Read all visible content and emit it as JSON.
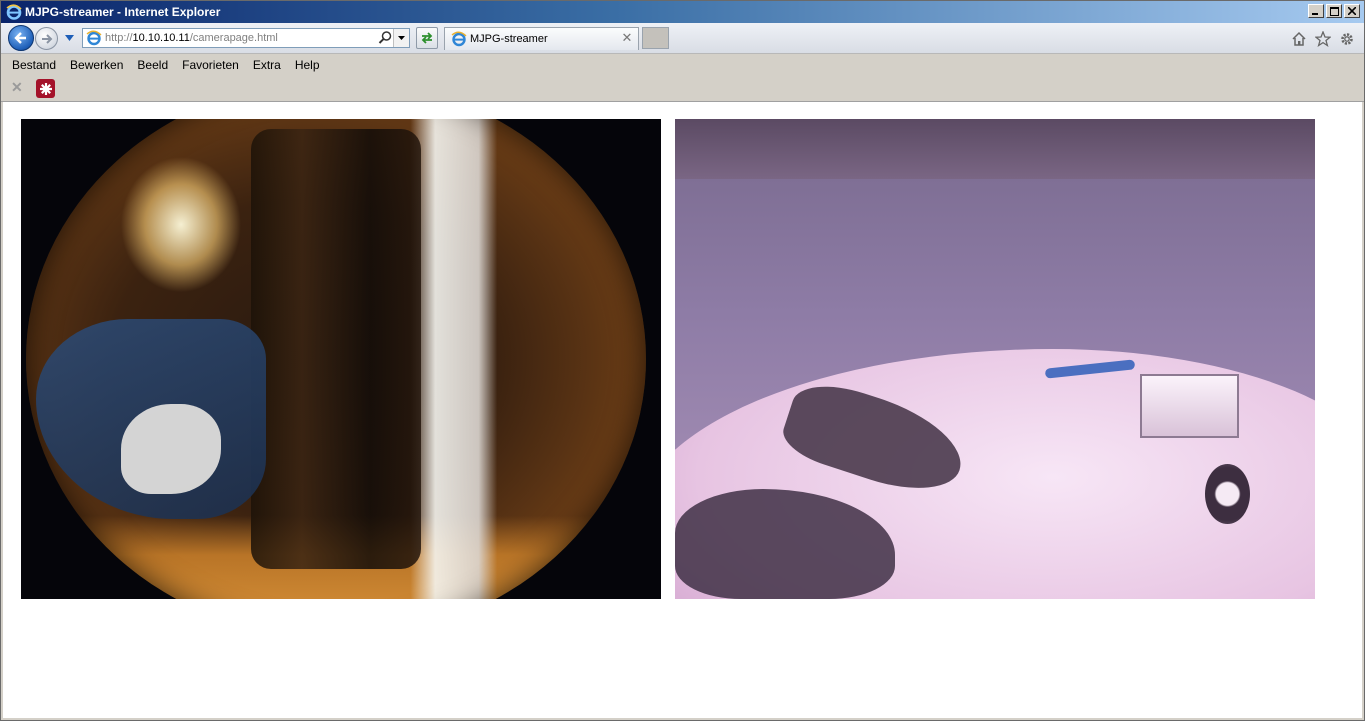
{
  "window": {
    "title": "MJPG-streamer - Internet Explorer",
    "controls": [
      "minimize-icon",
      "maximize-icon",
      "close-icon"
    ]
  },
  "navigation": {
    "back_icon": "back-arrow-icon",
    "forward_icon": "forward-arrow-icon",
    "history_icon": "chevron-down-icon",
    "address": {
      "prefix": "http://",
      "host": "10.10.10.11",
      "path": "/camerapage.html"
    },
    "refresh_icon": "compatibility-refresh-icon"
  },
  "tabs": [
    {
      "label": "MJPG-streamer",
      "active": true
    }
  ],
  "toolbar_icons": [
    "home-icon",
    "star-icon",
    "gear-icon"
  ],
  "menu": {
    "items": [
      "Bestand",
      "Bewerken",
      "Beeld",
      "Favorieten",
      "Extra",
      "Help"
    ]
  },
  "command_bar": {
    "icons": [
      "close-icon",
      "favorite-app-icon"
    ]
  },
  "content": {
    "streams": [
      {
        "name": "camera-stream-1",
        "description_icon": "fisheye-camera-feed"
      },
      {
        "name": "camera-stream-2",
        "description_icon": "workbench-camera-feed"
      }
    ]
  },
  "colors": {
    "titlebar_start": "#0a246a",
    "titlebar_end": "#a6caf0",
    "chrome": "#d4d0c8",
    "favorite_icon": "#a4122a"
  }
}
